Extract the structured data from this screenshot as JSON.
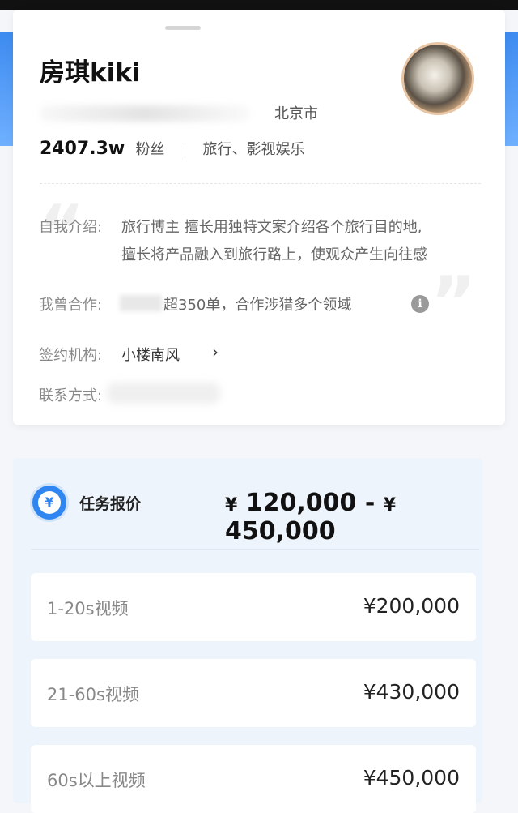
{
  "profile": {
    "name": "房琪kiki",
    "location": "北京市",
    "followers": "2407.3w",
    "followers_label": "粉丝",
    "category": "旅行、影视娱乐",
    "intro_label": "自我介绍:",
    "intro_line1": "旅行博主 擅长用独特文案介绍各个旅行目的地,",
    "intro_line2": "擅长将产品融入到旅行路上，使观众产生向往感",
    "coop_label": "我曾合作:",
    "coop_value": "超350单，合作涉猎多个领域",
    "org_label": "签约机构:",
    "org_value": "小楼南风",
    "contact_label": "联系方式:"
  },
  "pricing": {
    "title": "任务报价",
    "range_min": "120,000",
    "range_max": "450,000",
    "currency": "¥",
    "rows": [
      {
        "label": "1-20s视频",
        "price": "¥200,000"
      },
      {
        "label": "21-60s视频",
        "price": "¥430,000"
      },
      {
        "label": "60s以上视频",
        "price": "¥450,000"
      }
    ]
  },
  "colors": {
    "accent": "#2f86f0",
    "panel_bg": "#eef4fc"
  }
}
